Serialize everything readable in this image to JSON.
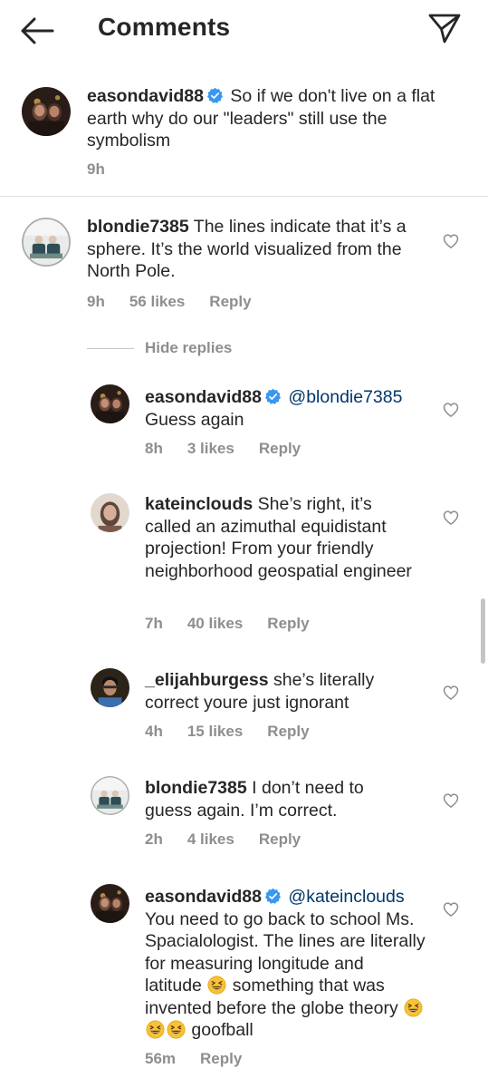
{
  "header": {
    "title": "Comments",
    "back_icon": "back-arrow-icon",
    "share_icon": "paper-plane-icon"
  },
  "caption": {
    "username": "easondavid88",
    "verified": true,
    "text": "So if we don't live on a flat earth why do our \"leaders\" still use the symbolism",
    "time": "9h"
  },
  "comments": [
    {
      "username": "blondie7385",
      "text": "The lines indicate that it’s a sphere. It’s the world visualized from the North Pole.",
      "time": "9h",
      "likes": "56 likes",
      "reply": "Reply",
      "hide_replies": "Hide replies"
    }
  ],
  "replies": [
    {
      "username": "easondavid88",
      "verified": true,
      "mention": "@blondie7385",
      "text": "Guess again",
      "time": "8h",
      "likes": "3 likes",
      "reply": "Reply"
    },
    {
      "username": "kateinclouds",
      "text": "She’s right, it’s called an azimuthal equidistant projection! From your friendly neighborhood geospatial engineer",
      "time": "7h",
      "likes": "40 likes",
      "reply": "Reply"
    },
    {
      "username": "_elijahburgess",
      "text": "she’s literally correct youre just ignorant",
      "time": "4h",
      "likes": "15 likes",
      "reply": "Reply"
    },
    {
      "username": "blondie7385",
      "text": "I don’t need to guess again. I’m correct.",
      "time": "2h",
      "likes": "4 likes",
      "reply": "Reply"
    },
    {
      "username": "easondavid88",
      "verified": true,
      "mention": "@kateinclouds",
      "text_a": "You need to go back to school Ms. Spacialologist. The lines are literally for measuring longitude and latitude",
      "text_b": "something that was invented before the globe theory",
      "text_c": "goofball",
      "emoji": "grinning-squinting-face",
      "time": "56m",
      "reply": "Reply"
    }
  ],
  "colors": {
    "text": "#262626",
    "secondary": "#8e8e8e",
    "mention": "#00376b",
    "verified": "#3897f0",
    "divider": "#e3e3e3"
  }
}
